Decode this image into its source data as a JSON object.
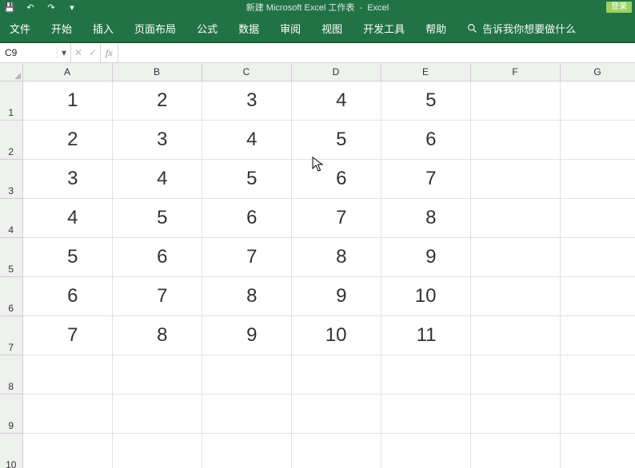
{
  "title": {
    "doc": "新建 Microsoft Excel 工作表",
    "app": "Excel",
    "login": "登录"
  },
  "qat": {
    "save": "💾",
    "undo": "↶",
    "redo": "↷",
    "dropdown": "▾"
  },
  "ribbon": {
    "tabs": [
      "文件",
      "开始",
      "插入",
      "页面布局",
      "公式",
      "数据",
      "审阅",
      "视图",
      "开发工具",
      "帮助"
    ],
    "tellme_placeholder": "告诉我你想要做什么"
  },
  "formulabar": {
    "name": "C9",
    "cancel": "✕",
    "enter": "✓",
    "fx": "fx",
    "formula": ""
  },
  "grid": {
    "columns": [
      "A",
      "B",
      "C",
      "D",
      "E",
      "F",
      "G"
    ],
    "row_labels": [
      "1",
      "2",
      "3",
      "4",
      "5",
      "6",
      "7",
      "8",
      "9",
      "10"
    ],
    "rows": [
      [
        "1",
        "2",
        "3",
        "4",
        "5",
        "",
        ""
      ],
      [
        "2",
        "3",
        "4",
        "5",
        "6",
        "",
        ""
      ],
      [
        "3",
        "4",
        "5",
        "6",
        "7",
        "",
        ""
      ],
      [
        "4",
        "5",
        "6",
        "7",
        "8",
        "",
        ""
      ],
      [
        "5",
        "6",
        "7",
        "8",
        "9",
        "",
        ""
      ],
      [
        "6",
        "7",
        "8",
        "9",
        "10",
        "",
        ""
      ],
      [
        "7",
        "8",
        "9",
        "10",
        "11",
        "",
        ""
      ],
      [
        "",
        "",
        "",
        "",
        "",
        "",
        ""
      ],
      [
        "",
        "",
        "",
        "",
        "",
        "",
        ""
      ],
      [
        "",
        "",
        "",
        "",
        "",
        "",
        ""
      ]
    ]
  }
}
